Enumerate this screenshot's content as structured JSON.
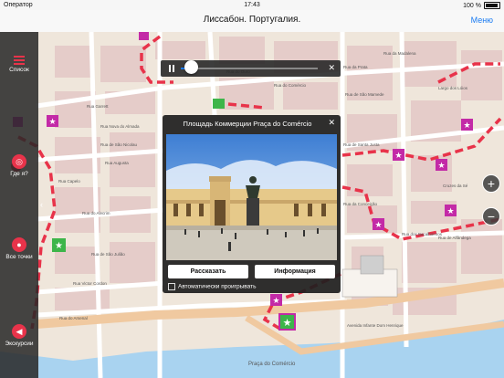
{
  "status_bar": {
    "carrier": "Оператор",
    "time": "17:43",
    "battery_percent": "100 %"
  },
  "header": {
    "title": "Лиссабон. Португалия.",
    "menu_label": "Меню"
  },
  "sidebar": {
    "items": [
      {
        "label": "Список",
        "icon": "list-icon"
      },
      {
        "label": "Где я?",
        "icon": "locate-icon"
      },
      {
        "label": "Все точки",
        "icon": "pin-icon"
      },
      {
        "label": "Экскурсии",
        "icon": "audio-tour-icon"
      }
    ],
    "collapse_glyph": "‹"
  },
  "audio_player": {
    "progress": 0.08,
    "close_glyph": "✕"
  },
  "popup": {
    "title": "Площадь Коммерции Praça do Comércio",
    "close_glyph": "✕",
    "tell_button": "Рассказать",
    "info_button": "Информация",
    "autoplay_label": "Автоматически проигрывать"
  },
  "zoom": {
    "in": "+",
    "out": "−"
  },
  "map_labels": {
    "r1": "Rua Garrett",
    "r2": "Rua Capelo",
    "r3": "Rua do Alecrim",
    "r4": "Rua do Ouro",
    "r5": "Rua da Prata",
    "r6": "Rua da Madalena",
    "r7": "Rua Victor Cordon",
    "r8": "Rua do Arsenal",
    "r9": "Avenida Infante Dom Henrique",
    "r10": "Praça do Comércio",
    "r11": "Largo dos Lóios",
    "r12": "Cruzes da Sé",
    "r13": "Rua de São Mamede",
    "r14": "Rua Nova do Almada",
    "r15": "Rua de São Nicolau",
    "r16": "Rua de São Julião",
    "r17": "Rua dos Bacalhoeiros",
    "r18": "Rua do Comércio",
    "r19": "Rua Augusta",
    "r20": "Rua de Santa Justa",
    "r21": "Rua da Conceição",
    "r22": "Rua de Alfândega"
  },
  "colors": {
    "accent": "#1a7bf2",
    "sidebar_icon": "#e8334a",
    "route": "#e8334a",
    "poi_marker": "#c32aa7",
    "poi_active": "#3db54a"
  }
}
